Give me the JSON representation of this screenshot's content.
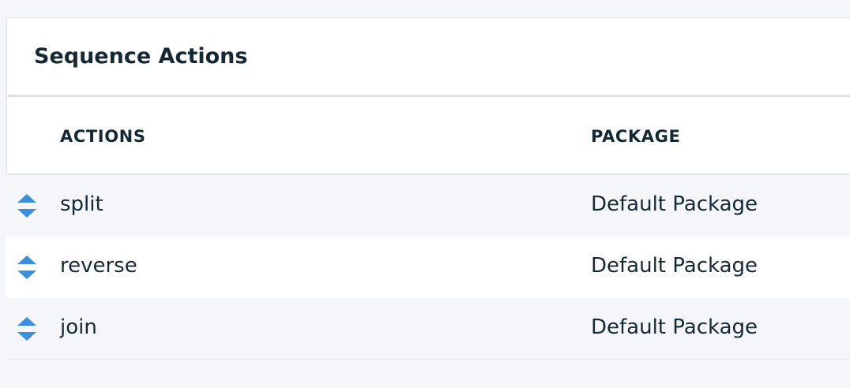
{
  "panel": {
    "title": "Sequence Actions"
  },
  "table": {
    "columns": {
      "actions": "ACTIONS",
      "package": "PACKAGE"
    },
    "rows": [
      {
        "action": "split",
        "package": "Default Package"
      },
      {
        "action": "reverse",
        "package": "Default Package"
      },
      {
        "action": "join",
        "package": "Default Package"
      }
    ]
  },
  "colors": {
    "accent": "#3d8fdc",
    "text": "#152935",
    "row_alt": "#f4f6fa",
    "border": "#dfe3e6"
  },
  "icons": {
    "handle": "drag-sort-icon"
  }
}
